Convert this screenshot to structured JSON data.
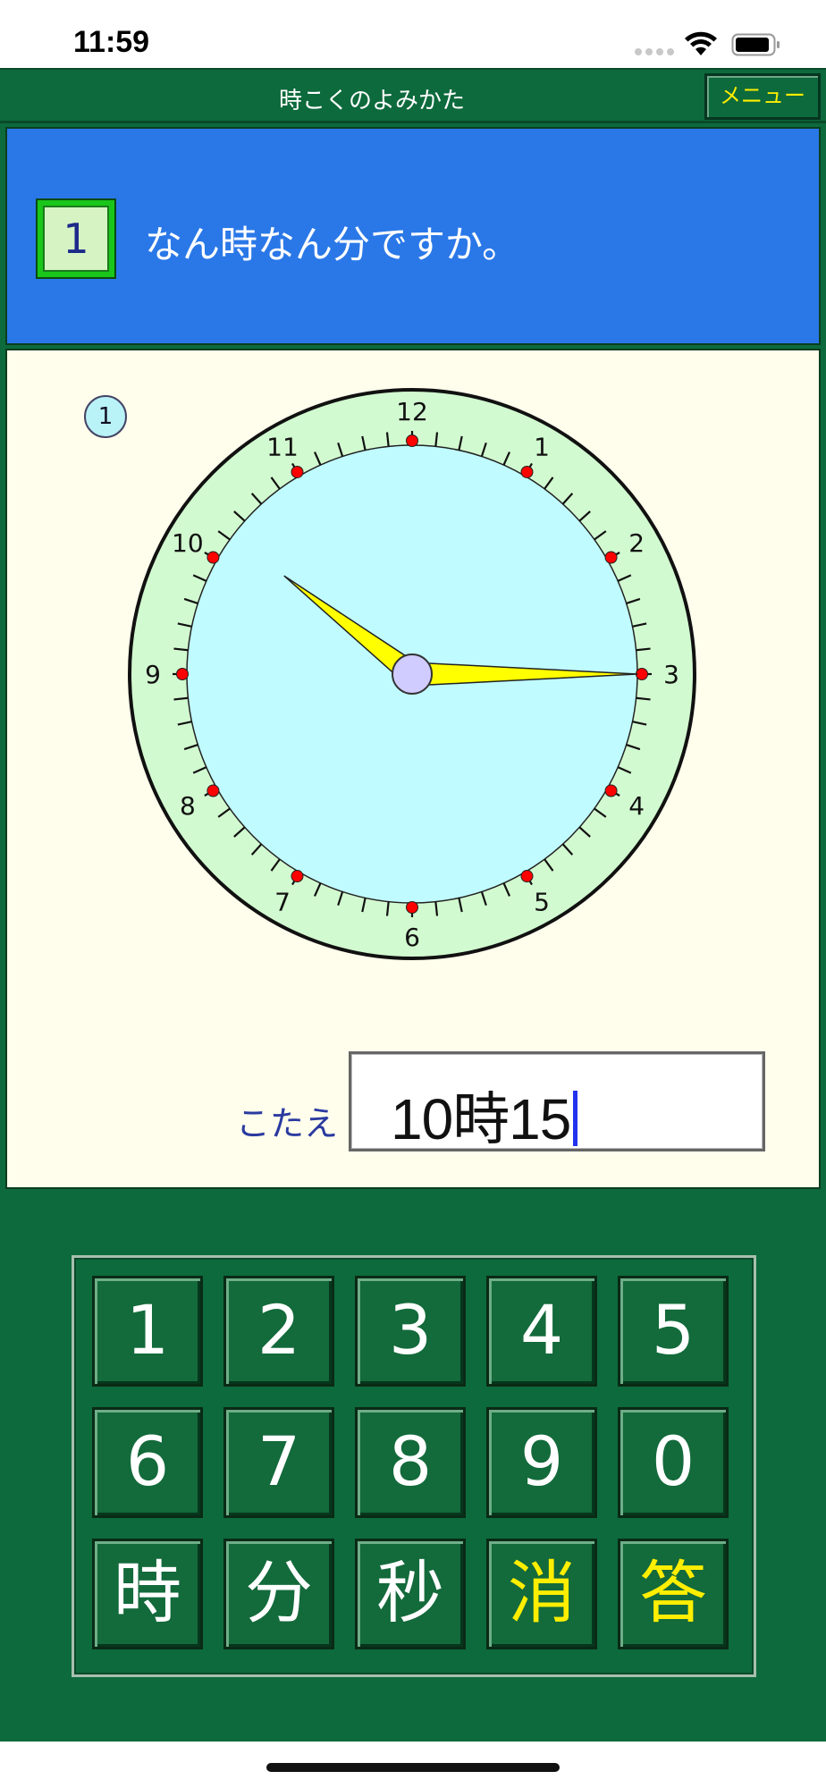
{
  "status_bar": {
    "time": "11:59"
  },
  "header": {
    "title": "時こくのよみかた",
    "menu_label": "メニュー"
  },
  "question": {
    "number": "1",
    "text": "なん時なん分ですか。"
  },
  "problem": {
    "index_label": "1"
  },
  "clock": {
    "numbers": [
      "12",
      "1",
      "2",
      "3",
      "4",
      "5",
      "6",
      "7",
      "8",
      "9",
      "10",
      "11"
    ],
    "hour_value": 10.25,
    "minute_value": 15,
    "colors": {
      "face": "#c0fbff",
      "ring": "#d2fad0",
      "hands": "#ffff00",
      "hub": "#d0ccff",
      "hour_dots": "#ff0000"
    }
  },
  "answer": {
    "label": "こたえ",
    "value": "10時15"
  },
  "keypad": {
    "rows": [
      [
        "1",
        "2",
        "3",
        "4",
        "5"
      ],
      [
        "6",
        "7",
        "8",
        "9",
        "0"
      ],
      [
        "時",
        "分",
        "秒",
        "消",
        "答"
      ]
    ],
    "key_names": [
      [
        "key-1",
        "key-2",
        "key-3",
        "key-4",
        "key-5"
      ],
      [
        "key-6",
        "key-7",
        "key-8",
        "key-9",
        "key-0"
      ],
      [
        "key-hour",
        "key-minute",
        "key-second",
        "key-clear",
        "key-answer"
      ]
    ],
    "highlight_keys": [
      "消",
      "答"
    ]
  }
}
